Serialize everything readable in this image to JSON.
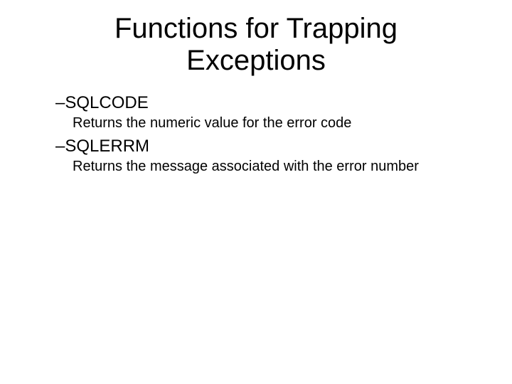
{
  "title_line1": "Functions for Trapping",
  "title_line2": "Exceptions",
  "items": [
    {
      "dash": "–",
      "term": "SQLCODE",
      "desc": "Returns the numeric value for the error code"
    },
    {
      "dash": "–",
      "term": "SQLERRM",
      "desc": "Returns the message associated with the error number"
    }
  ]
}
